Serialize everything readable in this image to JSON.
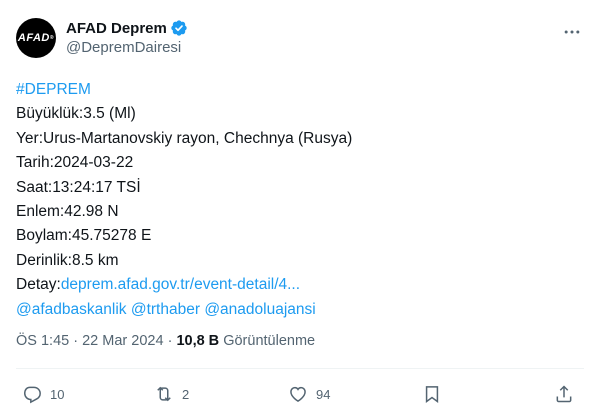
{
  "account": {
    "display_name": "AFAD Deprem",
    "handle": "@DepremDairesi",
    "avatar_text": "AFAD",
    "avatar_reg": "®",
    "verified_icon": "verified-badge-icon"
  },
  "tweet": {
    "hashtag": "#DEPREM",
    "lines": {
      "magnitude": "Büyüklük:3.5 (Ml)",
      "place": "Yer:Urus-Martanovskiy rayon, Chechnya (Rusya)",
      "date": "Tarih:2024-03-22",
      "time": "Saat:13:24:17 TSİ",
      "lat": "Enlem:42.98 N",
      "lon": "Boylam:45.75278 E",
      "depth": "Derinlik:8.5 km"
    },
    "detail_label": "Detay:",
    "detail_link": "deprem.afad.gov.tr/event-detail/4...",
    "mentions": [
      "@afadbaskanlik",
      "@trthaber",
      "@anadoluajansi"
    ]
  },
  "meta": {
    "time": "ÖS 1:45",
    "separator": "·",
    "date": "22 Mar 2024",
    "views_count": "10,8 B",
    "views_label": "Görüntülenme"
  },
  "actions": {
    "replies": "10",
    "retweets": "2",
    "likes": "94"
  },
  "colors": {
    "link": "#1d9bf0",
    "text": "#0f1419",
    "secondary": "#536471"
  }
}
